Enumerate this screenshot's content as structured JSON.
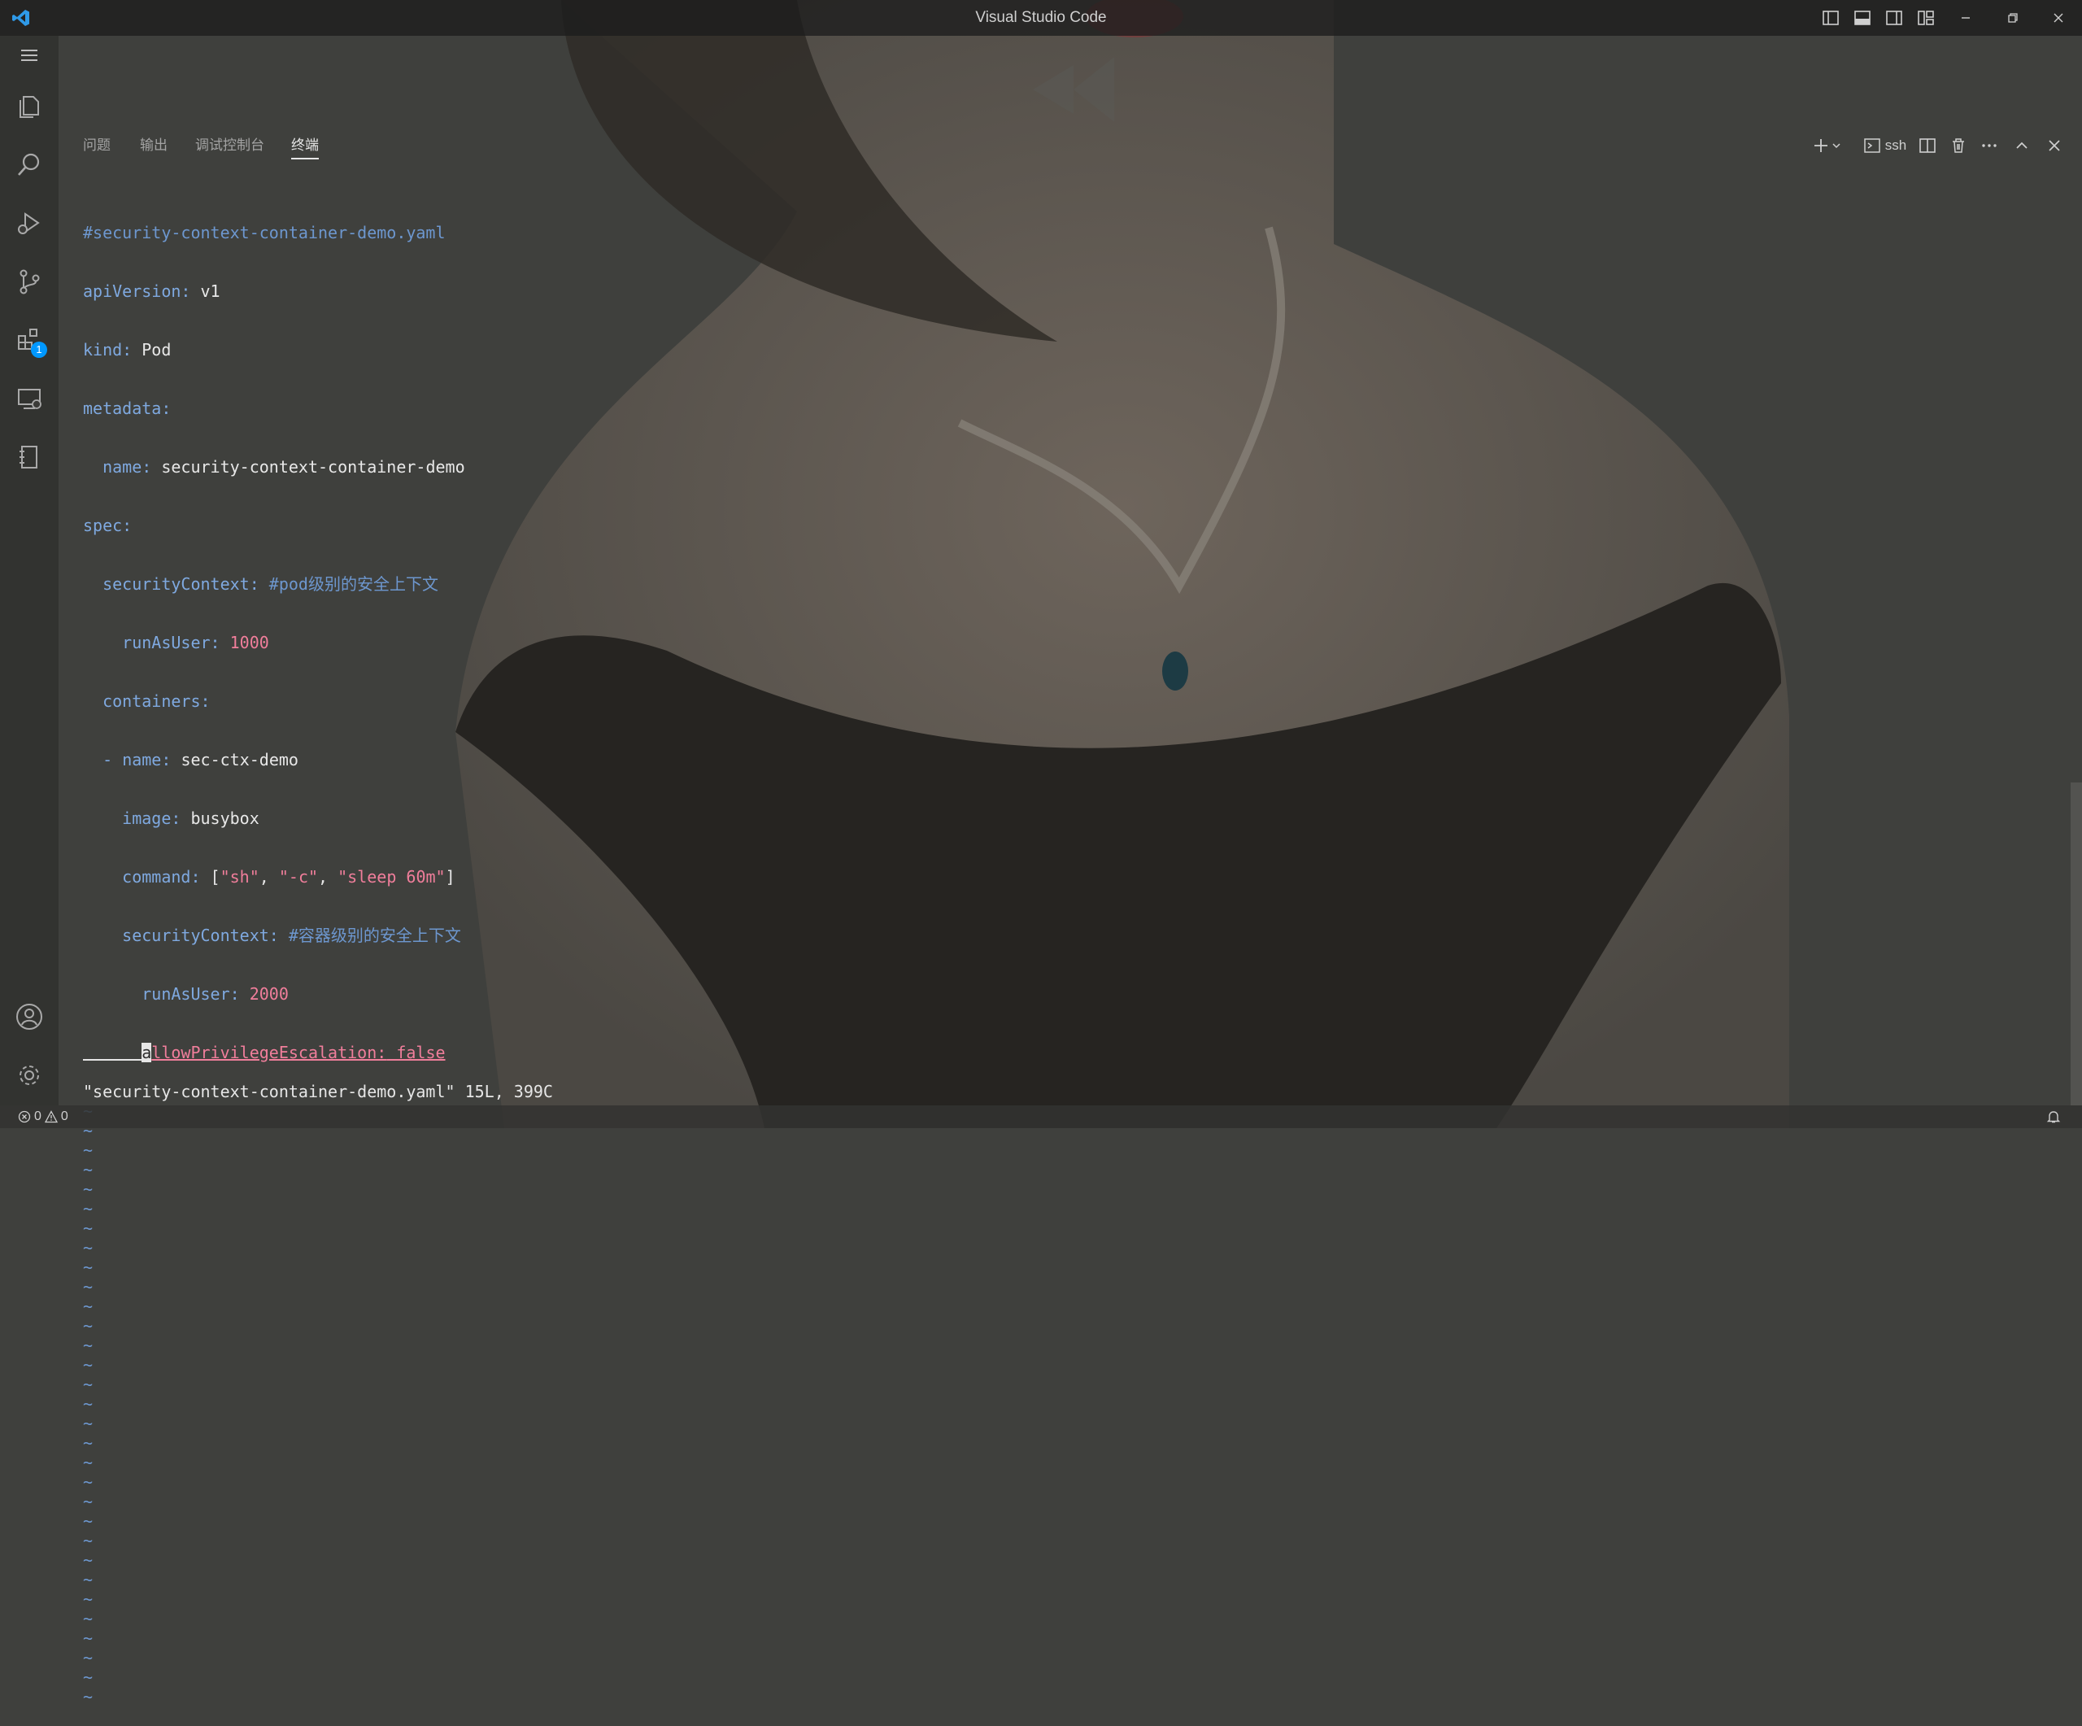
{
  "window": {
    "title": "Visual Studio Code"
  },
  "panel": {
    "tabs": [
      {
        "label": "问题",
        "active": false
      },
      {
        "label": "输出",
        "active": false
      },
      {
        "label": "调试控制台",
        "active": false
      },
      {
        "label": "终端",
        "active": true
      }
    ],
    "terminal_name": "ssh"
  },
  "activity_bar": {
    "extensions_badge": "1"
  },
  "terminal": {
    "lines": [
      "#security-context-container-demo.yaml",
      "apiVersion: v1",
      "kind: Pod",
      "metadata:",
      "  name: security-context-container-demo",
      "spec:",
      "  securityContext: #pod级别的安全上下文",
      "    runAsUser: 1000",
      "  containers:",
      "  - name: sec-ctx-demo",
      "    image: busybox",
      "    command: [\"sh\", \"-c\", \"sleep 60m\"]",
      "    securityContext: #容器级别的安全上下文",
      "      runAsUser: 2000",
      "      allowPrivilegeEscalation: false"
    ],
    "tilde": "~",
    "tilde_count": 31,
    "status_message": "\"security-context-container-demo.yaml\" 15L, 399C"
  },
  "statusbar": {
    "errors": "0",
    "warnings": "0"
  },
  "colors": {
    "accent": "#0098ff",
    "comment": "#6d97cf",
    "key": "#7fa9e0",
    "number": "#f07e9b"
  }
}
